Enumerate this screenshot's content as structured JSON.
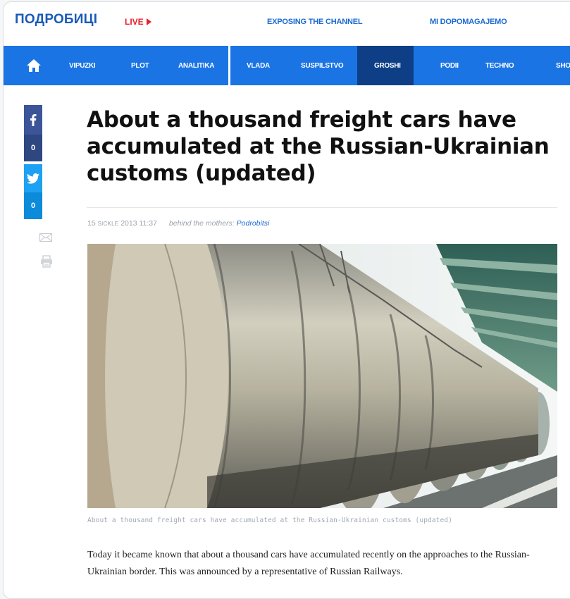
{
  "header": {
    "logo": "ПОДРОБИЦІ",
    "live_label": "LIVE",
    "links": [
      "EXPOSING THE CHANNEL",
      "MI DOPOMAGAJEMO"
    ]
  },
  "nav": {
    "items": [
      "VIPUZKI",
      "PLOT",
      "ANALITIKA",
      "VLADA",
      "SUSPILSTVO",
      "GROSHI",
      "PODII",
      "TECHNO",
      "SHO"
    ],
    "active": "GROSHI"
  },
  "social": {
    "facebook_count": "0",
    "twitter_count": "0"
  },
  "article": {
    "title": "About a thousand freight cars have accumulated at the Russian-Ukrainian customs (updated)",
    "date_day": "15",
    "date_month": "SICKLE",
    "date_rest": "2013 11:37",
    "byline_label": "behind the mothers:",
    "author": "Podrobitsi",
    "caption": "About a thousand freight cars have accumulated at the Russian-Ukrainian customs (updated)",
    "body": "Today it became known that about a thousand cars have accumulated recently on the approaches to the Russian-Ukrainian border. This was announced by a representative of Russian Railways."
  },
  "colors": {
    "brand_blue": "#1b74e4",
    "nav_active": "#0e3f86",
    "live_red": "#e8202a",
    "facebook": "#3b5598",
    "twitter": "#1ea1f2"
  }
}
